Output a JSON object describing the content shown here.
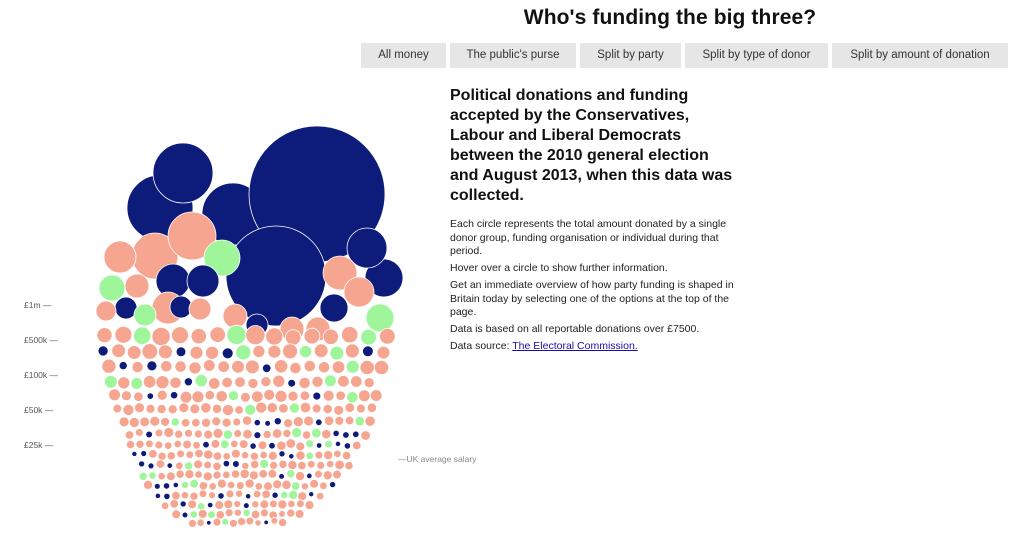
{
  "title": "Who's funding the big three?",
  "nav": {
    "buttons": [
      "All money",
      "The public's purse",
      "Split by party",
      "Split by type of donor",
      "Split by amount of donation"
    ]
  },
  "scale": {
    "labels": [
      "£1m —",
      "£500k —",
      "£100k —",
      "£50k —",
      "£25k —"
    ],
    "salary_label": "—UK average salary"
  },
  "info": {
    "headline": "Political donations and funding accepted by the Conservatives, Labour and Liberal Democrats between the 2010 general election and August 2013, when this data was collected.",
    "paragraphs": [
      "Each circle represents the total amount donated by a single donor group, funding organisation or individual during that period.",
      "Hover over a circle to show further information.",
      "Get an immediate overview of how party funding is shaped in Britain today by selecting one of the options at the top of the page.",
      "Data is based on all reportable donations over £7500."
    ],
    "source_prefix": "Data source: ",
    "source_link": "The Electoral Commission."
  },
  "colors": {
    "conservative": "#0d1b7a",
    "labour": "#f6a690",
    "libdem": "#9ef59a",
    "button_bg": "#e6e6e6"
  }
}
